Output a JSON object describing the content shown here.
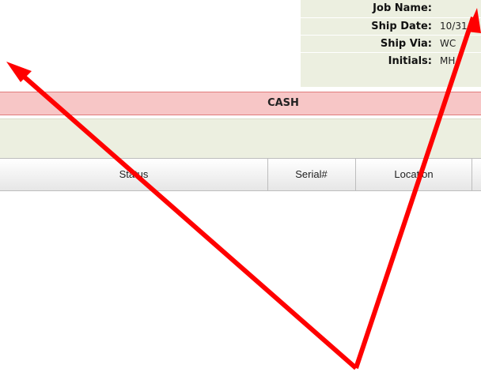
{
  "info_panel": {
    "rows": [
      {
        "label": "Job Name:",
        "value": ""
      },
      {
        "label": "Ship Date:",
        "value": "10/31"
      },
      {
        "label": "Ship Via:",
        "value": "WC"
      },
      {
        "label": "Initials:",
        "value": "MH"
      }
    ]
  },
  "banner": {
    "text": "CASH",
    "color": "#f7c6c6"
  },
  "table": {
    "columns": [
      "Status",
      "Serial#",
      "Location",
      ""
    ]
  },
  "annotation": {
    "arrow_color": "#ff0000"
  }
}
